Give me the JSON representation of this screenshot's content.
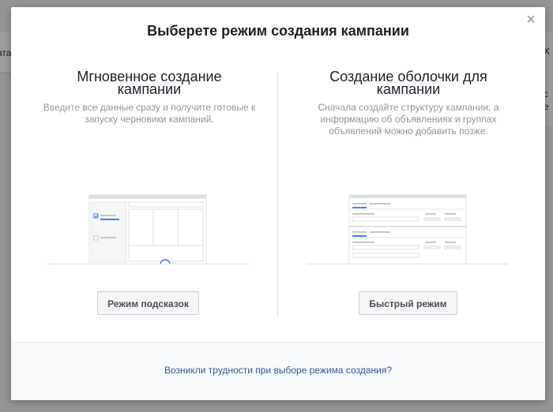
{
  "background": {
    "left_fragment": "ата",
    "right_fragments": [
      "Х",
      "с",
      "е"
    ]
  },
  "modal": {
    "title": "Выберете режим создания кампании",
    "close_glyph": "×",
    "options": [
      {
        "title": "Мгновенное создание кампании",
        "description": "Введите все данные сразу и получите готовые к запуску черновики кампаний.",
        "button_label": "Режим подсказок"
      },
      {
        "title": "Создание оболочки для кампании",
        "description": "Сначала создайте структуру кампании, а информацию об объявлениях и группах объявлений можно добавить позже.",
        "button_label": "Быстрый режим"
      }
    ],
    "footer_link": "Возникли трудности при выборе режима создания?"
  },
  "colors": {
    "accent": "#4080ff",
    "link": "#365899",
    "muted_text": "#90949c"
  }
}
